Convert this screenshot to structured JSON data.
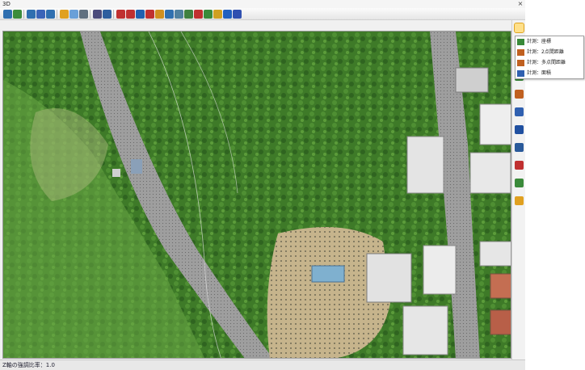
{
  "window": {
    "title": "3D",
    "close_glyph": "×"
  },
  "toolbar": {
    "buttons": [
      {
        "icon": "open-icon",
        "color": "#2f6fb0"
      },
      {
        "icon": "save-icon",
        "color": "#3c8c3c"
      },
      {
        "icon": "zoom-extents-icon",
        "color": "#2f6fb0"
      },
      {
        "icon": "zoom-icon",
        "color": "#3a64b8"
      },
      {
        "icon": "zoom-window-icon",
        "color": "#2f6fb0"
      },
      {
        "icon": "rotate-icon",
        "color": "#e0a020"
      },
      {
        "icon": "view-icon",
        "color": "#6aa0d8"
      },
      {
        "icon": "settings-icon",
        "color": "#607080"
      },
      {
        "icon": "tool-icon",
        "color": "#4c4c7c"
      },
      {
        "icon": "layer-icon",
        "color": "#2e5e9e"
      },
      {
        "icon": "measure-line-icon",
        "color": "#c03030"
      },
      {
        "icon": "measure-path-icon",
        "color": "#c03030"
      },
      {
        "icon": "measure-angle-icon",
        "color": "#2060b0"
      },
      {
        "icon": "measure-area-icon",
        "color": "#c03030"
      },
      {
        "icon": "mountain-icon",
        "color": "#d09020"
      },
      {
        "icon": "profile-icon",
        "color": "#3070b0"
      },
      {
        "icon": "section-icon",
        "color": "#5080a0"
      },
      {
        "icon": "terrain-icon",
        "color": "#408040"
      },
      {
        "icon": "flag-icon",
        "color": "#c03030"
      },
      {
        "icon": "bookmark-icon",
        "color": "#3a8a3a"
      },
      {
        "icon": "marker-icon",
        "color": "#d0a020"
      },
      {
        "icon": "stack-icon",
        "color": "#2060c0"
      },
      {
        "icon": "export-icon",
        "color": "#3050b0"
      }
    ]
  },
  "sidebar": {
    "buttons": [
      {
        "icon": "measure-icon",
        "color": "#e8b020",
        "active": true
      },
      {
        "icon": "coordinate-icon",
        "color": "#3a8a3a",
        "active": false
      },
      {
        "icon": "distance-icon",
        "color": "#c06020",
        "active": false
      },
      {
        "icon": "area-icon",
        "color": "#3060b0",
        "active": false
      },
      {
        "icon": "volume-icon",
        "color": "#2050a0",
        "active": false
      },
      {
        "icon": "profile-icon",
        "color": "#2a5a9a",
        "active": false
      },
      {
        "icon": "pen-icon",
        "color": "#c03030",
        "active": false
      },
      {
        "icon": "capture-icon",
        "color": "#3a8a3a",
        "active": false
      },
      {
        "icon": "help-icon",
        "color": "#e0a020",
        "active": false
      }
    ]
  },
  "flyout": {
    "items": [
      {
        "label": "計測：座標",
        "icon": "coordinate-icon"
      },
      {
        "label": "計測：2点間距離",
        "icon": "distance-icon"
      },
      {
        "label": "計測：多点間距離",
        "icon": "multi-distance-icon"
      },
      {
        "label": "計測：面積",
        "icon": "area-icon"
      }
    ]
  },
  "status": {
    "text": "Z軸の強調比率：1.0"
  },
  "map": {
    "forest_color": "#3e7a28",
    "road_color": "#9a9a9a",
    "building_color": "#e6e6e6"
  }
}
